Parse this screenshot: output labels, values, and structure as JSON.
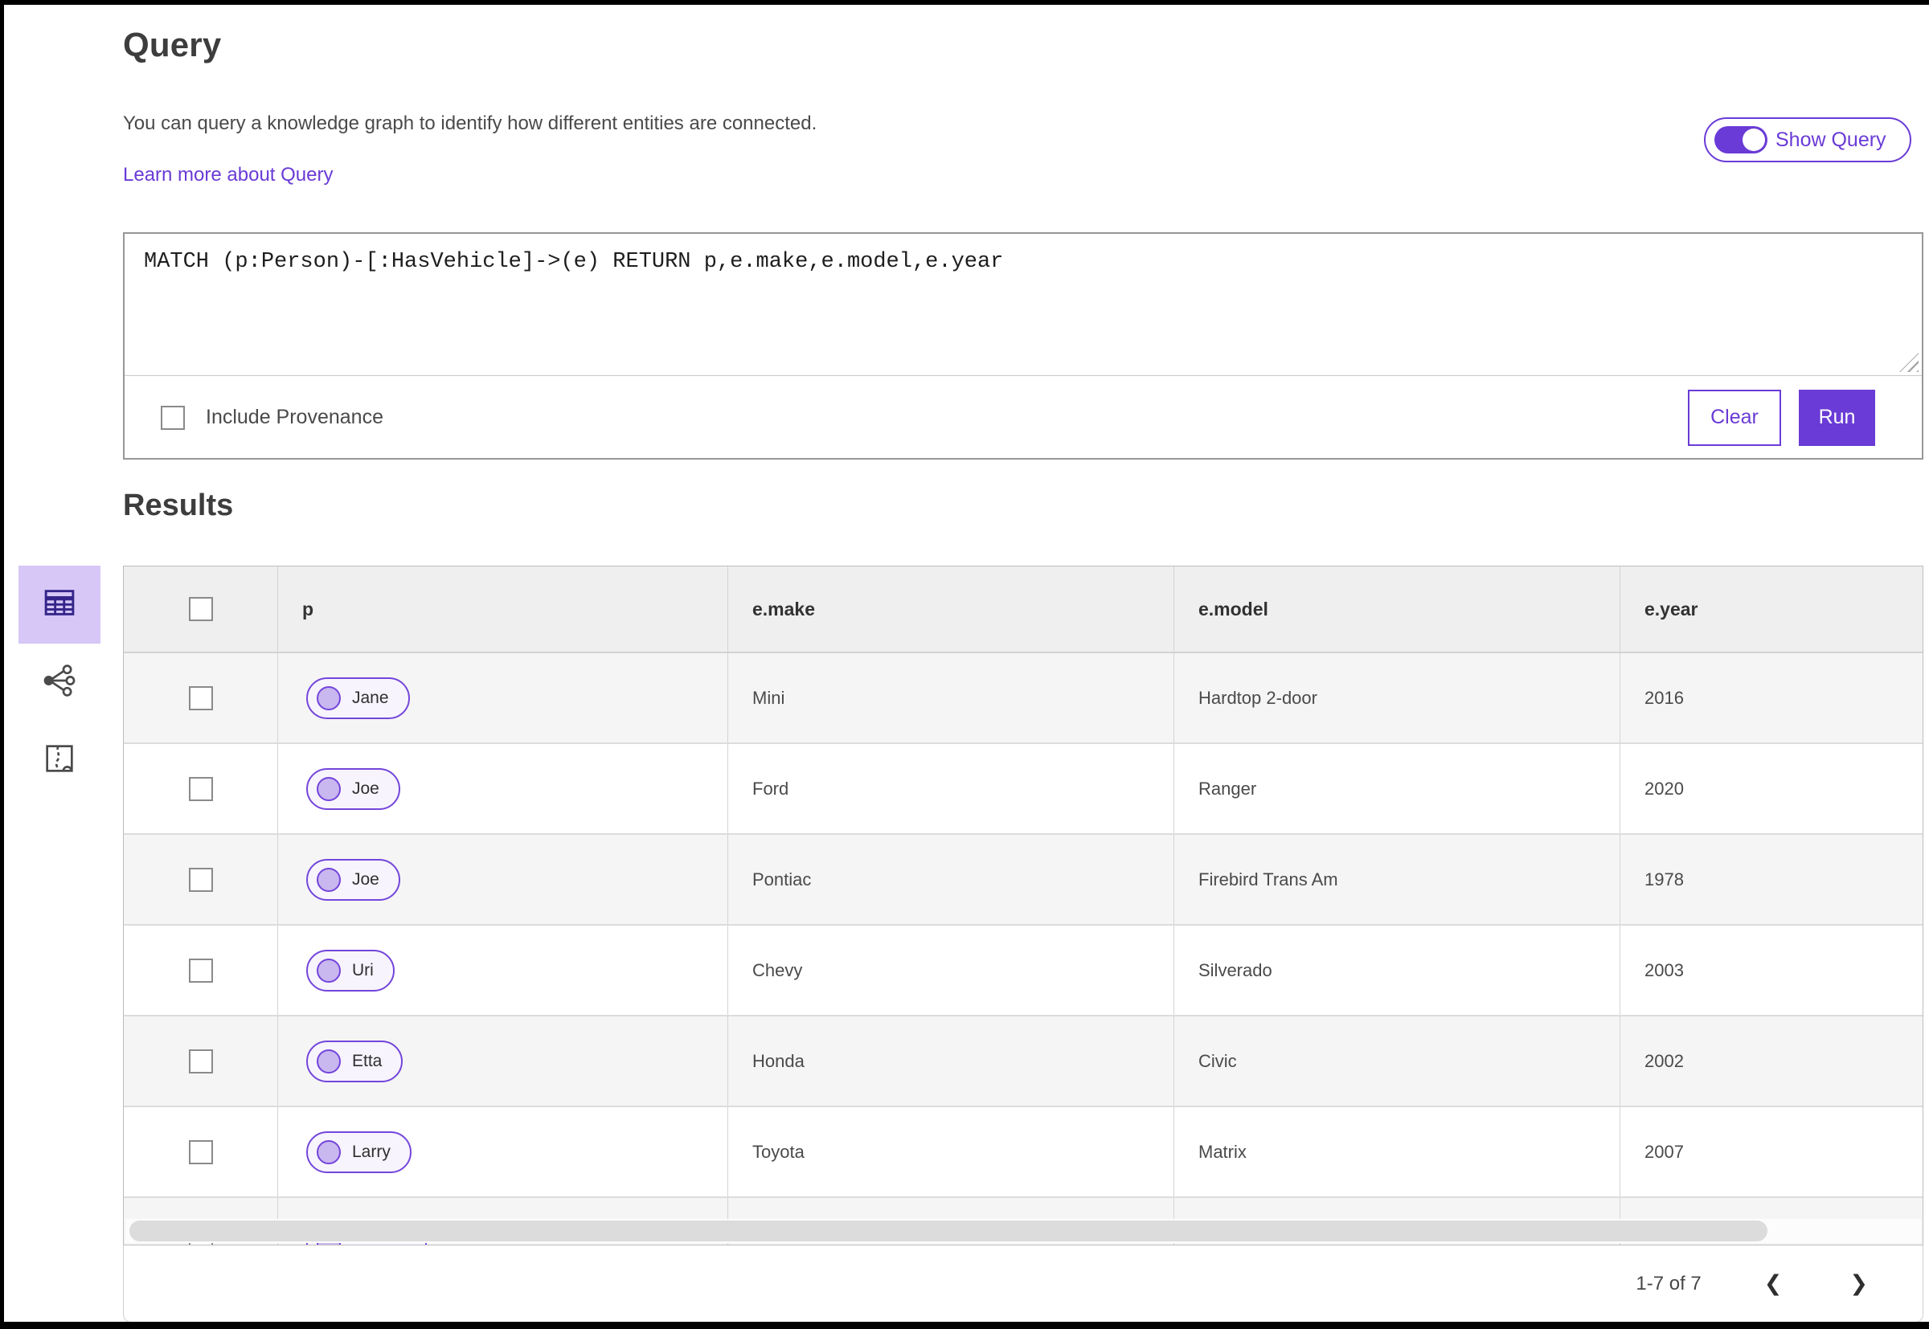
{
  "header": {
    "title": "Query",
    "description": "You can query a knowledge graph to identify how different entities are connected.",
    "learn_more_label": "Learn more about Query",
    "show_query_label": "Show Query",
    "show_query_on": true
  },
  "query_editor": {
    "query_text": "MATCH (p:Person)-[:HasVehicle]->(e) RETURN p,e.make,e.model,e.year",
    "include_provenance_label": "Include Provenance",
    "include_provenance_checked": false,
    "clear_label": "Clear",
    "run_label": "Run"
  },
  "results": {
    "title": "Results",
    "view_tabs": [
      {
        "label": "table-view",
        "icon": "table-icon",
        "selected": true
      },
      {
        "label": "link-chart-view",
        "icon": "link-chart-icon",
        "selected": false
      },
      {
        "label": "map-view",
        "icon": "map-icon",
        "selected": false
      }
    ],
    "table": {
      "columns": [
        "p",
        "e.make",
        "e.model",
        "e.year"
      ],
      "rows": [
        {
          "p": "Jane",
          "make": "Mini",
          "model": "Hardtop 2-door",
          "year": "2016"
        },
        {
          "p": "Joe",
          "make": "Ford",
          "model": "Ranger",
          "year": "2020"
        },
        {
          "p": "Joe",
          "make": "Pontiac",
          "model": "Firebird Trans Am",
          "year": "1978"
        },
        {
          "p": "Uri",
          "make": "Chevy",
          "model": "Silverado",
          "year": "2003"
        },
        {
          "p": "Etta",
          "make": "Honda",
          "model": "Civic",
          "year": "2002"
        },
        {
          "p": "Larry",
          "make": "Toyota",
          "model": "Matrix",
          "year": "2007"
        },
        {
          "p": "",
          "make": "",
          "model": "",
          "year": ""
        }
      ]
    },
    "pagination": {
      "range_label": "1-7 of 7",
      "prev_icon": "❮",
      "next_icon": "❯"
    }
  },
  "colors": {
    "primary_purple": "#6a3bd6",
    "pill_border": "#7445db",
    "pill_fill": "#f7f4fd",
    "pill_dot": "#c9b7ef",
    "selected_tab_bg": "#d6c7f6",
    "selected_tab_icon": "#35258a",
    "table_header_bg": "#efefef",
    "row_alt_bg": "#f5f5f5"
  }
}
